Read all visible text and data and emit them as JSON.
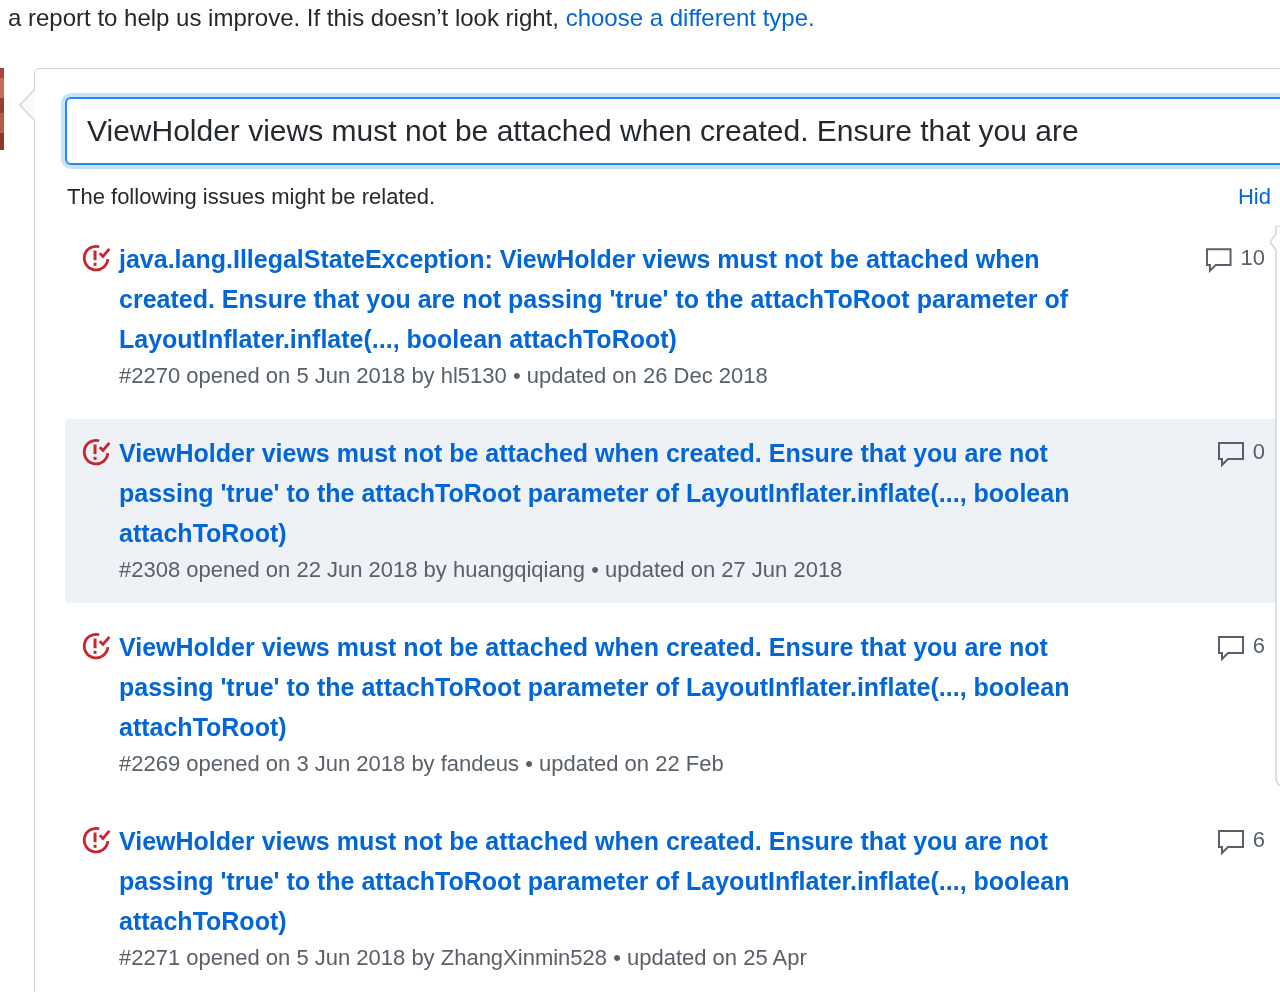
{
  "intro": {
    "text": "a report to help us improve. If this doesn’t look right, ",
    "link": "choose a different type."
  },
  "title_field": {
    "value": "ViewHolder views must not be attached when created. Ensure that you are"
  },
  "related": {
    "note": "The following issues might be related.",
    "hide_link": "Hid"
  },
  "issues": [
    {
      "title": "java.lang.IllegalStateException: ViewHolder views must not be attached when created. Ensure that you are not passing 'true' to the attachToRoot parameter of LayoutInflater.inflate(..., boolean attachToRoot)",
      "meta": "#2270 opened on 5 Jun 2018 by hl5130 • updated on 26 Dec 2018",
      "comments": "10",
      "selected": false
    },
    {
      "title": "ViewHolder views must not be attached when created. Ensure that you are not passing 'true' to the attachToRoot parameter of LayoutInflater.inflate(..., boolean attachToRoot)",
      "meta": "#2308 opened on 22 Jun 2018 by huangqiqiang • updated on 27 Jun 2018",
      "comments": "0",
      "selected": true
    },
    {
      "title": "ViewHolder views must not be attached when created. Ensure that you are not passing 'true' to the attachToRoot parameter of LayoutInflater.inflate(..., boolean attachToRoot)",
      "meta": "#2269 opened on 3 Jun 2018 by fandeus • updated on 22 Feb",
      "comments": "6",
      "selected": false
    },
    {
      "title": "ViewHolder views must not be attached when created. Ensure that you are not passing 'true' to the attachToRoot parameter of LayoutInflater.inflate(..., boolean attachToRoot)",
      "meta": "#2271 opened on 5 Jun 2018 by ZhangXinmin528 • updated on 25 Apr",
      "comments": "6",
      "selected": false
    }
  ]
}
